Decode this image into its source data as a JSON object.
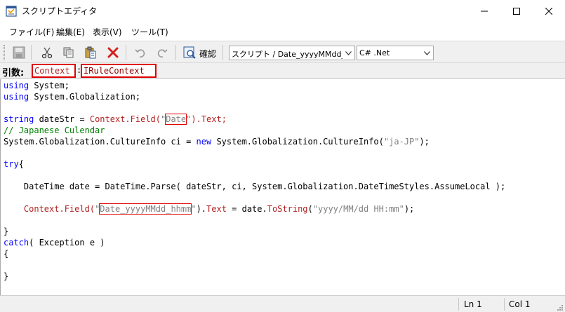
{
  "window": {
    "title": "スクリプトエディタ",
    "icon": "script-editor-icon"
  },
  "menu": {
    "items": [
      {
        "label": "ファイル(F)"
      },
      {
        "label": "編集(E)"
      },
      {
        "label": "表示(V)"
      },
      {
        "label": "ツール(T)"
      }
    ]
  },
  "toolbar": {
    "check_label": "確認",
    "script_select": "スクリプト / Date_yyyyMMdd_hhm",
    "language_select": "C# .Net"
  },
  "arguments": {
    "label": "引数:",
    "context_name": "Context",
    "colon": ":",
    "context_type": "IRuleContext"
  },
  "code": {
    "l1_kw": "using",
    "l1_rest": " System;",
    "l2_kw": "using",
    "l2_rest": " System.Globalization;",
    "l3_kw": "string",
    "l3_a": " dateStr = ",
    "l3_ctx": "Context.Field(",
    "l3_q1": "\"",
    "l3_field": "Date",
    "l3_q2": "\"",
    "l3_end": ").Text;",
    "l4_comment": "// Japanese Culendar",
    "l5_a": "System.Globalization.CultureInfo ci = ",
    "l5_kw": "new",
    "l5_b": " System.Globalization.CultureInfo(",
    "l5_str": "\"ja-JP\"",
    "l5_end": ");",
    "l6_kw": "try",
    "l6_rest": "{",
    "l7": "    DateTime date = DateTime.Parse( dateStr, ci, System.Globalization.DateTimeStyles.AssumeLocal );",
    "l8_indent": "    ",
    "l8_ctx": "Context.Field(",
    "l8_q1": "\"",
    "l8_field": "Date_yyyyMMdd_hhmm",
    "l8_q2": "\"",
    "l8_mid": ").",
    "l8_text": "Text",
    "l8_eq": " = date.",
    "l8_tostr": "ToString",
    "l8_p": "(",
    "l8_fmt": "\"yyyy/MM/dd HH:mm\"",
    "l8_end": ");",
    "l9": "}",
    "l10_kw": "catch",
    "l10_rest": "( Exception e )",
    "l11": "{",
    "l12": "}"
  },
  "status": {
    "line": "Ln 1",
    "col": "Col 1"
  }
}
